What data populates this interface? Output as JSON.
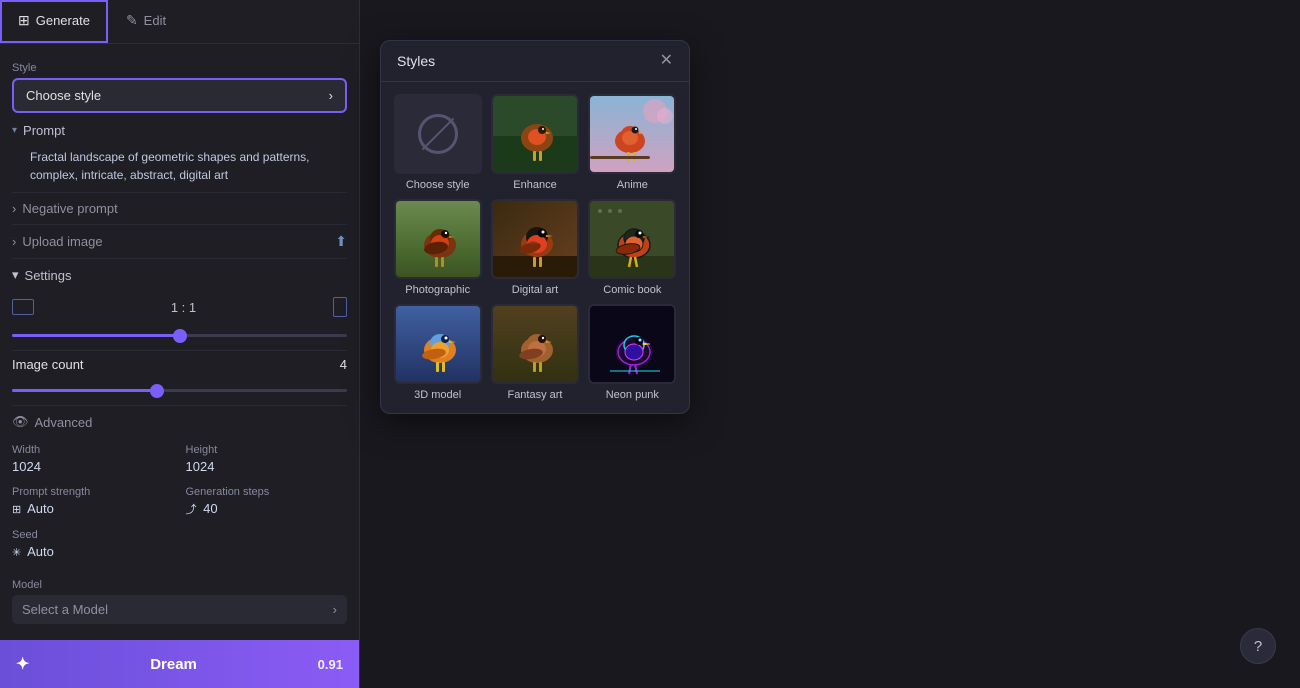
{
  "tabs": [
    {
      "id": "generate",
      "label": "Generate",
      "icon": "⊞",
      "active": true
    },
    {
      "id": "edit",
      "label": "Edit",
      "icon": "✎",
      "active": false
    }
  ],
  "style_selector": {
    "label": "Style",
    "value": "Choose style",
    "placeholder": "Choose style"
  },
  "prompt_section": {
    "label": "Prompt",
    "text": "Fractal landscape of geometric shapes and patterns, complex, intricate, abstract, digital art",
    "expanded": true
  },
  "negative_prompt": {
    "label": "Negative prompt",
    "expanded": false
  },
  "upload_image": {
    "label": "Upload image"
  },
  "settings": {
    "label": "Settings",
    "expanded": true,
    "aspect_ratio": "1 : 1",
    "image_count_label": "Image count",
    "image_count_value": "4",
    "advanced_label": "Advanced",
    "width_label": "Width",
    "width_value": "1024",
    "height_label": "Height",
    "height_value": "1024",
    "prompt_strength_label": "Prompt strength",
    "prompt_strength_value": "Auto",
    "generation_steps_label": "Generation steps",
    "generation_steps_value": "40",
    "seed_label": "Seed",
    "seed_value": "Auto",
    "model_label": "Model",
    "model_value": "Select a Model"
  },
  "dream_button": {
    "label": "Dream",
    "cost": "0.91"
  },
  "styles_modal": {
    "title": "Styles",
    "items": [
      {
        "id": "none",
        "label": "Choose style",
        "type": "none"
      },
      {
        "id": "enhance",
        "label": "Enhance",
        "type": "bird",
        "bg": "#3a6040"
      },
      {
        "id": "anime",
        "label": "Anime",
        "type": "bird",
        "bg": "#2a4a60"
      },
      {
        "id": "photographic",
        "label": "Photographic",
        "type": "bird",
        "bg": "#4a5030"
      },
      {
        "id": "digital_art",
        "label": "Digital art",
        "type": "bird",
        "bg": "#5a3a30"
      },
      {
        "id": "comic_book",
        "label": "Comic book",
        "type": "bird",
        "bg": "#3a4a30"
      },
      {
        "id": "style7",
        "label": "3D model",
        "type": "bird",
        "bg": "#2a4060"
      },
      {
        "id": "style8",
        "label": "Fantasy art",
        "type": "bird",
        "bg": "#404030"
      },
      {
        "id": "style9",
        "label": "Neon punk",
        "type": "bird",
        "bg": "#2a2060"
      }
    ]
  },
  "help_button": "?"
}
